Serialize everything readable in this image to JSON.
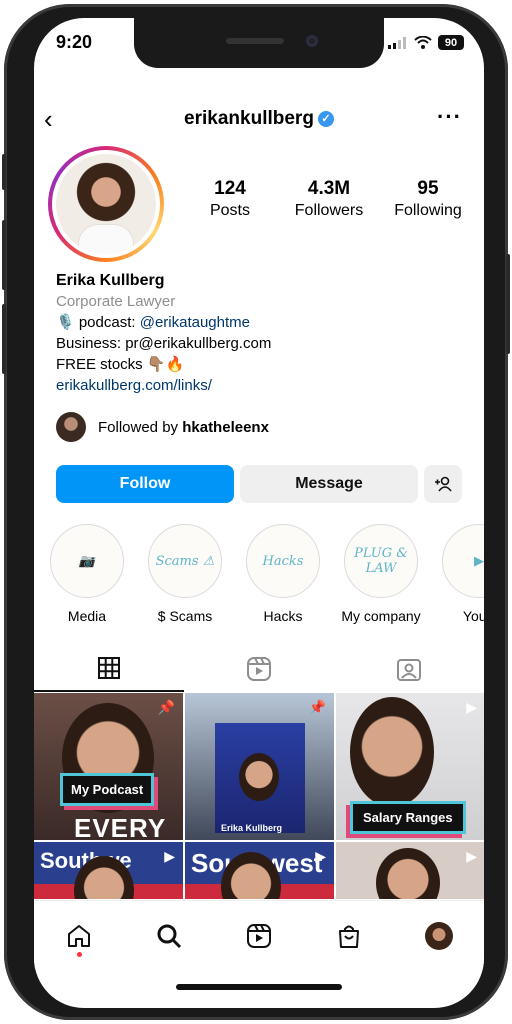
{
  "status_bar": {
    "time": "9:20",
    "battery": "90",
    "signal_icon": "signal-icon",
    "wifi_icon": "wifi-icon"
  },
  "header": {
    "back_icon": "chevron-left-icon",
    "username": "erikankullberg",
    "verified_icon": "verified-check-icon",
    "more_icon": "more-horizontal-icon"
  },
  "stats": [
    {
      "value": "124",
      "label": "Posts"
    },
    {
      "value": "4.3M",
      "label": "Followers"
    },
    {
      "value": "95",
      "label": "Following"
    }
  ],
  "bio": {
    "name": "Erika Kullberg",
    "category": "Corporate Lawyer",
    "line1_prefix": "🎙️ podcast: ",
    "line1_handle": "@erikataughtme",
    "line2": "Business: pr@erikakullberg.com",
    "line3": "FREE stocks 👇🏽🔥",
    "link": "erikakullberg.com/links/"
  },
  "followed_by": {
    "prefix": "Followed by ",
    "user": "hkatheleenx"
  },
  "actions": {
    "follow": "Follow",
    "message": "Message",
    "add_user_icon": "add-user-icon"
  },
  "highlights": [
    {
      "label": "Media",
      "inner": "📷"
    },
    {
      "label": "$ Scams",
      "inner": "Scams ⚠"
    },
    {
      "label": "Hacks",
      "inner": "Hacks"
    },
    {
      "label": "My company",
      "inner": "PLUG & LAW"
    },
    {
      "label": "YouT",
      "inner": "▶"
    }
  ],
  "tabs": [
    {
      "name": "grid",
      "icon": "grid-icon",
      "glyph": "▦"
    },
    {
      "name": "reels",
      "icon": "reels-icon",
      "glyph": "▶"
    },
    {
      "name": "tagged",
      "icon": "tagged-icon",
      "glyph": "👤"
    }
  ],
  "posts": {
    "p1_caption": "My Podcast",
    "p1_bottom_text": "EVERY",
    "p2_caption": "Erika Kullberg",
    "p3_caption": "Salary Ranges",
    "p4_text": "Southwe",
    "p5_text": "Southwest"
  },
  "bottom_nav": [
    {
      "name": "home",
      "icon": "home-icon"
    },
    {
      "name": "search",
      "icon": "search-icon"
    },
    {
      "name": "reels",
      "icon": "reels-icon"
    },
    {
      "name": "shop",
      "icon": "shop-icon"
    },
    {
      "name": "profile",
      "icon": "profile-avatar"
    }
  ]
}
